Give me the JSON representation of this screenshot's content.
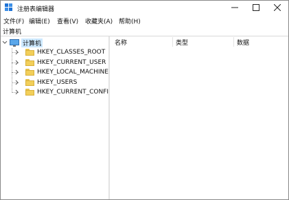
{
  "window": {
    "title": "注册表编辑器"
  },
  "menu": [
    "文件(F)",
    "编辑(E)",
    "查看(V)",
    "收藏夹(A)",
    "帮助(H)"
  ],
  "address": "计算机",
  "tree": {
    "root": "计算机",
    "children": [
      "HKEY_CLASSES_ROOT",
      "HKEY_CURRENT_USER",
      "HKEY_LOCAL_MACHINE",
      "HKEY_USERS",
      "HKEY_CURRENT_CONFIG"
    ]
  },
  "columns": [
    "名称",
    "类型",
    "数据"
  ],
  "colors": {
    "selection": "#cce8ff",
    "folder": "#f2cf5a",
    "app_icon": "#1e73d6"
  },
  "icons": [
    "registry-editor-icon",
    "minimize-icon",
    "maximize-icon",
    "close-icon",
    "computer-icon",
    "folder-icon",
    "chevron-right-icon"
  ]
}
